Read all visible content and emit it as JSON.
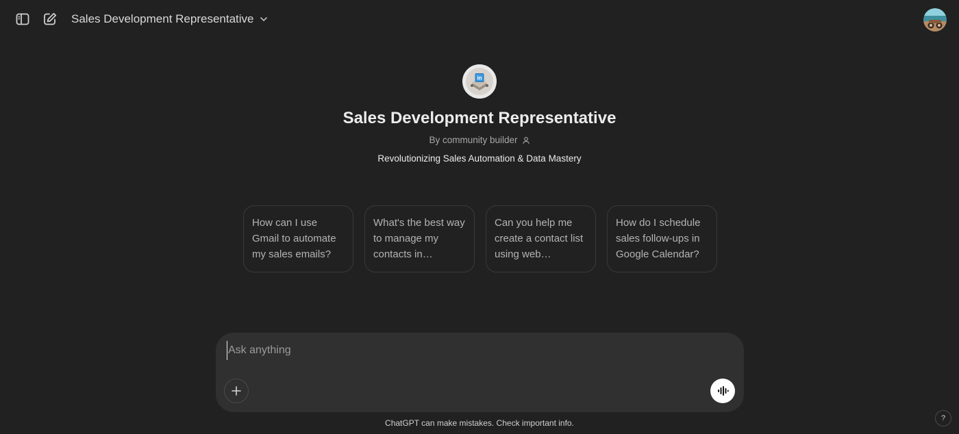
{
  "header": {
    "model_title": "Sales Development Representative",
    "sidebar_toggle_icon": "sidebar-toggle-icon",
    "new_chat_icon": "new-chat-icon",
    "dropdown_icon": "chevron-down-icon"
  },
  "gpt": {
    "name": "Sales Development Representative",
    "author": "By community builder",
    "description": "Revolutionizing Sales Automation & Data Mastery"
  },
  "suggestions": [
    "How can I use Gmail to automate my sales emails?",
    "What's the best way to manage my contacts in…",
    "Can you help me create a contact list using web research?",
    "How do I schedule sales follow-ups in Google Calendar?"
  ],
  "composer": {
    "placeholder": "Ask anything"
  },
  "footer": {
    "disclaimer": "ChatGPT can make mistakes. Check important info.",
    "help_label": "?"
  },
  "colors": {
    "background": "#212121",
    "composer": "#303030",
    "text": "#ececec"
  }
}
